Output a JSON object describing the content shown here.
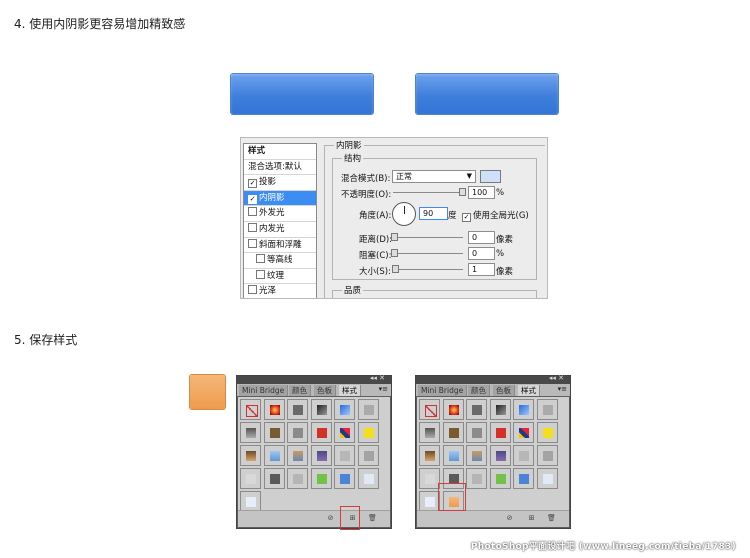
{
  "headings": {
    "step4": "4. 使用内阴影更容易增加精致感",
    "step5": "5. 保存样式"
  },
  "colors": {
    "button_blue": "#3f7fdc",
    "swatch_orange": "#ef9b4d",
    "selection_blue": "#3b8cf3",
    "highlight_red": "#d43c3c"
  },
  "dialog": {
    "style_list": {
      "header": "样式",
      "items": [
        {
          "label": "混合选项:默认",
          "checkbox": false,
          "checked": false,
          "selected": false
        },
        {
          "label": "投影",
          "checkbox": true,
          "checked": true,
          "selected": false
        },
        {
          "label": "内阴影",
          "checkbox": true,
          "checked": true,
          "selected": true
        },
        {
          "label": "外发光",
          "checkbox": true,
          "checked": false,
          "selected": false
        },
        {
          "label": "内发光",
          "checkbox": true,
          "checked": false,
          "selected": false
        },
        {
          "label": "斜面和浮雕",
          "checkbox": true,
          "checked": false,
          "selected": false
        },
        {
          "label": "等高线",
          "checkbox": true,
          "checked": false,
          "selected": false
        },
        {
          "label": "纹理",
          "checkbox": true,
          "checked": false,
          "selected": false
        },
        {
          "label": "光泽",
          "checkbox": true,
          "checked": false,
          "selected": false
        }
      ]
    },
    "section_title": "内阴影",
    "group_structure": "结构",
    "blend_mode_label": "混合模式(B):",
    "blend_mode_value": "正常",
    "opacity_label": "不透明度(O):",
    "opacity_value": "100",
    "opacity_unit": "%",
    "angle_label": "角度(A):",
    "angle_value": "90",
    "angle_unit": "度",
    "global_light_label": "使用全局光(G)",
    "global_light_checked": true,
    "distance_label": "距离(D):",
    "distance_value": "0",
    "distance_unit": "像素",
    "choke_label": "阻塞(C):",
    "choke_value": "0",
    "choke_unit": "%",
    "size_label": "大小(S):",
    "size_value": "1",
    "size_unit": "像素",
    "group_quality": "品质",
    "shadow_color": "#cfe0fb"
  },
  "panels": {
    "tabs": [
      "Mini Bridge",
      "颜色",
      "色板",
      "样式"
    ],
    "active_tab": "样式"
  },
  "watermark": "PhotoShop平面设计吧 (www.lineeg.com/tieba/1783)"
}
